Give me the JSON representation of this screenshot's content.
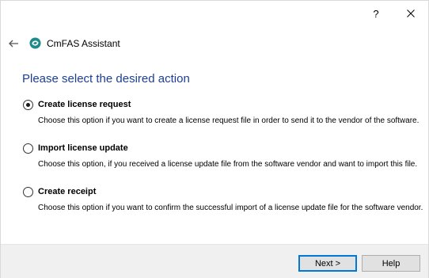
{
  "window": {
    "help_glyph": "?",
    "close_icon": "close-icon"
  },
  "header": {
    "app_title": "CmFAS Assistant",
    "logo_icon": "codemeter-logo-icon",
    "back_icon": "back-arrow-icon"
  },
  "main": {
    "heading": "Please select the desired action",
    "options": [
      {
        "label": "Create license request",
        "description": "Choose this option if you want to create a license request file in order to send it to the vendor of the software.",
        "selected": true
      },
      {
        "label": "Import license update",
        "description": "Choose this option, if you received a license update file from the software vendor and want to import this file.",
        "selected": false
      },
      {
        "label": "Create receipt",
        "description": "Choose this option if you want to confirm the successful import of a license update file for the software vendor.",
        "selected": false
      }
    ]
  },
  "footer": {
    "next_label": "Next >",
    "help_label": "Help"
  },
  "colors": {
    "heading": "#1c3f94",
    "logo": "#1e8a8a",
    "default_button_border": "#0078d7"
  }
}
